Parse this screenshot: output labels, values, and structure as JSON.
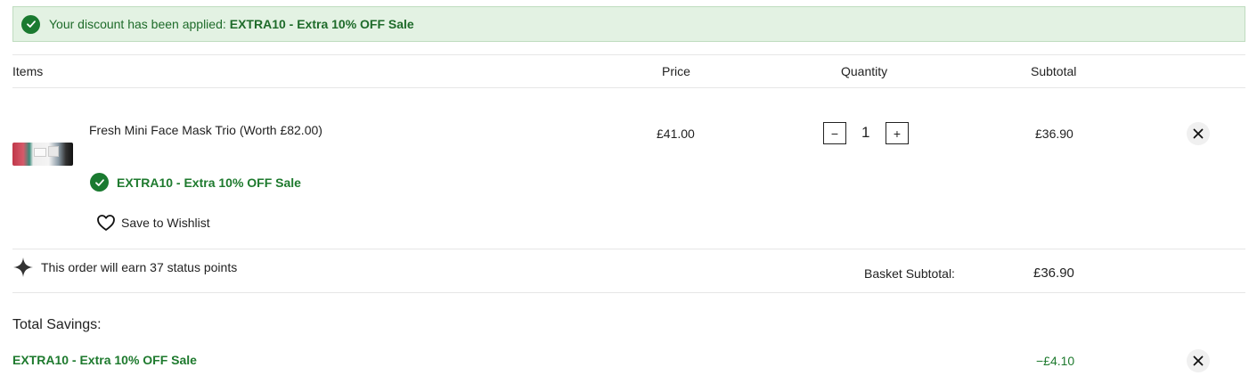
{
  "banner": {
    "message": "Your discount has been applied:",
    "code": "EXTRA10 - Extra 10% OFF Sale",
    "icon": "check-circle-icon"
  },
  "table_headers": {
    "items": "Items",
    "price": "Price",
    "quantity": "Quantity",
    "subtotal": "Subtotal"
  },
  "item": {
    "name": "Fresh Mini Face Mask Trio (Worth £82.00)",
    "price": "£41.00",
    "quantity": "1",
    "subtotal": "£36.90",
    "promo": "EXTRA10 - Extra 10% OFF Sale",
    "wishlist_label": "Save to Wishlist",
    "decrement_label": "−",
    "increment_label": "+"
  },
  "points": {
    "text": "This order will earn 37 status points",
    "icon": "sparkle-icon"
  },
  "basket": {
    "label": "Basket Subtotal:",
    "value": "£36.90"
  },
  "savings": {
    "title": "Total Savings:",
    "code": "EXTRA10 - Extra 10% OFF Sale",
    "amount": "−£4.10"
  },
  "colors": {
    "success_green": "#1e7a2e",
    "banner_bg": "#e3f2e3",
    "text": "#222222"
  }
}
